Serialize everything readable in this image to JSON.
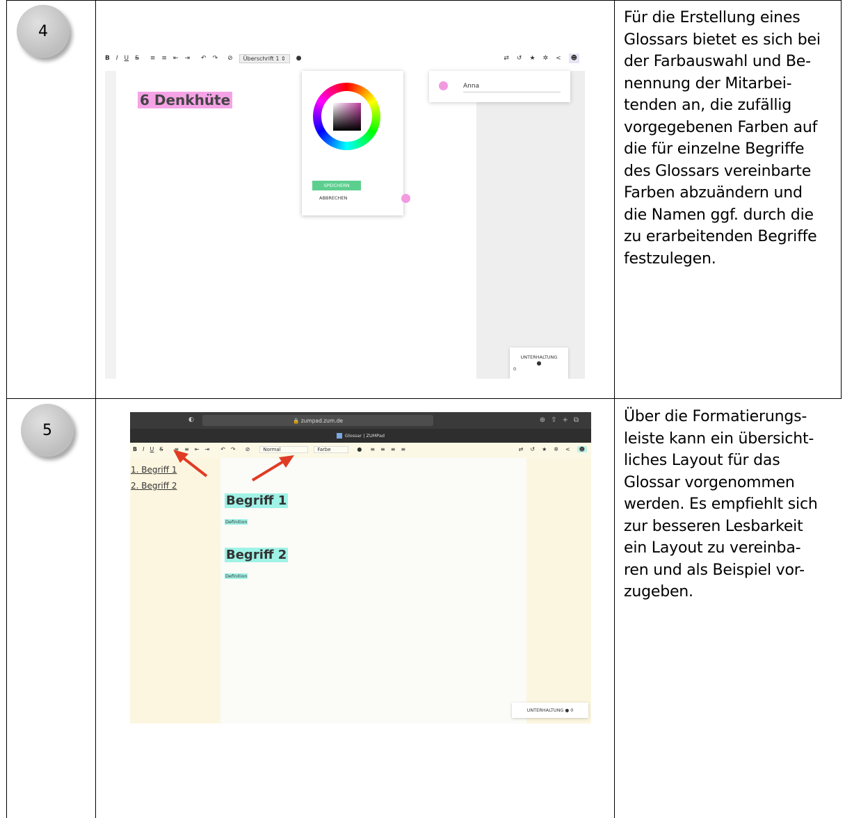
{
  "rows": [
    {
      "number": "4",
      "description": "Für die Erstellung eines\nGlossars bietet es sich bei\nder Farbauswahl und Be-\nnennung der Mitarbei-\ntenden an, die zufällig\nvorgegebenen Farben auf\ndie für einzelne Begriffe\ndes Glossars vereinbarte\nFarben abzuändern und\ndie Namen ggf. durch die\nzu erarbeitenden Begriffe\nfestzulegen."
    },
    {
      "number": "5",
      "description": "Über die Formatierungs-\nleiste kann ein übersicht-\nliches Layout für das\nGlossar vorgenommen\nwerden. Es empfiehlt sich\nzur besseren Lesbarkeit\nein Layout zu vereinba-\nren und als Beispiel vor-\nzugeben."
    }
  ],
  "shot1": {
    "toolbar_left": [
      "B",
      "I",
      "U",
      "S",
      "≡",
      "≡",
      "⇤",
      "⇥",
      "↶",
      "↷",
      "⊘"
    ],
    "heading_style": "Überschrift 1",
    "heading": "6 Denkhüte",
    "save_label": "SPEICHERN",
    "cancel_label": "ABBRECHEN",
    "user_name": "Anna",
    "chat_label": "UNTERHALTUNG",
    "chat_count": "0",
    "accent_color": "#f29ae0"
  },
  "shot2": {
    "url": "zumpad.zum.de",
    "tab_title": "Glossar | ZUMPad",
    "style_select": "Normal",
    "color_select": "Farbe",
    "toc": [
      "1. Begriff 1",
      "2. Begriff 2"
    ],
    "terms": [
      {
        "term": "Begriff 1",
        "definition": "Definition"
      },
      {
        "term": "Begriff 2",
        "definition": "Definition"
      }
    ],
    "chat_label": "UNTERHALTUNG",
    "chat_count": "0",
    "highlight_color": "#9ff2e6",
    "arrow_color": "#e03b24"
  }
}
